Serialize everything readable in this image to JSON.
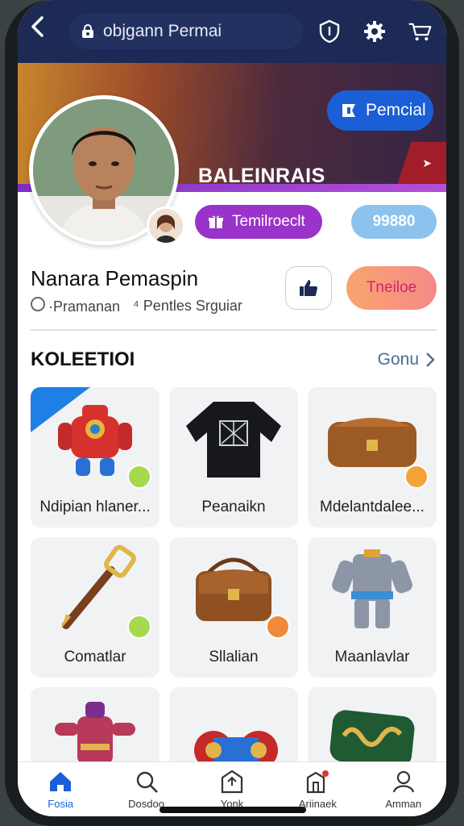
{
  "topbar": {
    "url_text": "objgann Permai",
    "icons": [
      "back-arrow-icon",
      "lock-icon",
      "shield-icon",
      "settings-gear-icon",
      "cart-icon"
    ]
  },
  "banner": {
    "premium_label": "Pemcial",
    "banner_name": "BALEINRAIS",
    "badge_label": "Temilroeclt",
    "score": "99880"
  },
  "profile": {
    "name": "Nanara Pemaspin",
    "sub_left": "·Pramanan",
    "sub_right": "Pentles Srguiar",
    "follow_label": "Tneiloe"
  },
  "collection": {
    "title": "KOLEETIOI",
    "see_all": "Gonu",
    "items": [
      {
        "label": "Ndipian hlaner..."
      },
      {
        "label": "Peanaikn"
      },
      {
        "label": "Mdelantdalee..."
      },
      {
        "label": "Comatlar"
      },
      {
        "label": "Sllalian"
      },
      {
        "label": "Maanlavlar"
      },
      {
        "label": ""
      },
      {
        "label": ""
      },
      {
        "label": ""
      }
    ]
  },
  "bottom_nav": [
    {
      "label": "Fosia",
      "icon": "home-icon"
    },
    {
      "label": "Dosdoo",
      "icon": "search-icon"
    },
    {
      "label": "Yonk",
      "icon": "box-icon"
    },
    {
      "label": "Ariinaek",
      "icon": "notifications-icon"
    },
    {
      "label": "Amman",
      "icon": "profile-icon"
    }
  ],
  "colors": {
    "topbar": "#1c2a55",
    "accent_blue": "#1b5fd6",
    "purple": "#9a33c9",
    "score_blue": "#8bc3ee",
    "follow_gradient": "#f9a46c"
  }
}
